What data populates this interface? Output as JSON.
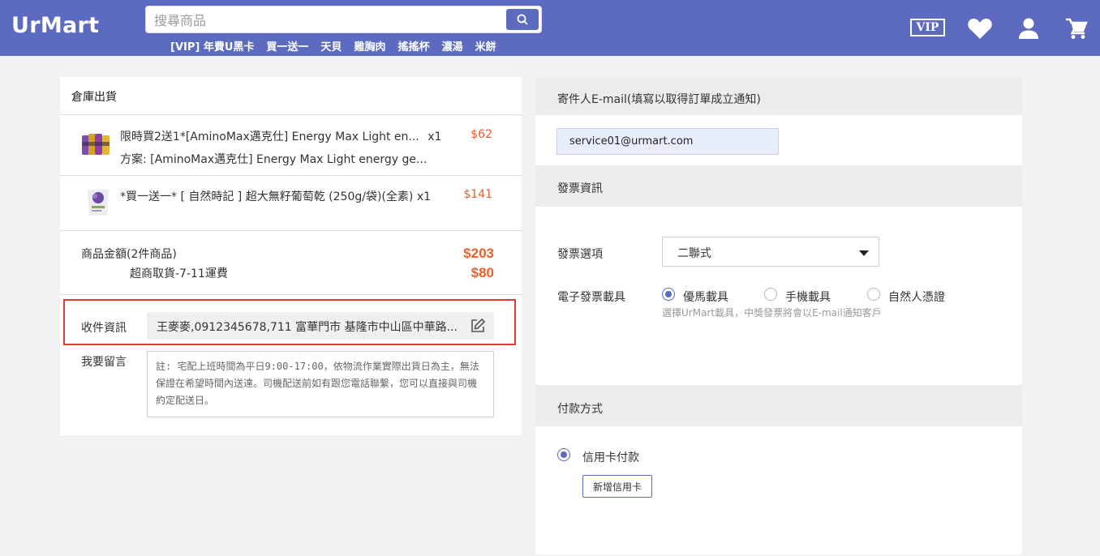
{
  "header": {
    "logo": "UrMart",
    "search_placeholder": "搜尋商品",
    "hot_links": [
      "[VIP] 年費U黑卡",
      "買一送一",
      "天貝",
      "雞胸肉",
      "搖搖杯",
      "濃湯",
      "米餅"
    ],
    "vip_label": "VIP",
    "icons": [
      "search-icon",
      "heart-icon",
      "user-icon",
      "cart-icon"
    ],
    "brand_color": "#5c6bc0"
  },
  "order": {
    "section_title": "倉庫出貨",
    "items": [
      {
        "name": "限時買2送1*[AminoMax邁克仕] Energy Max Light en...",
        "qty": "x1",
        "plan": "方案: [AminoMax邁克仕] Energy Max Light energy ge...",
        "price": "$62"
      },
      {
        "name": "*買一送一* [ 自然時記 ] 超大無籽葡萄乾 (250g/袋)(全素)",
        "qty": "x1",
        "plan": "",
        "price": "$141"
      }
    ],
    "subtotal_label": "商品金額(2件商品)",
    "subtotal": "$203",
    "shipping_label": "超商取貨-7-11運費",
    "shipping": "$80",
    "recipient_label": "收件資訊",
    "recipient_value": "王麥麥,0912345678,711 富華門市 基隆市中山區中華路...",
    "note_label": "我要留言",
    "note_text": "註: 宅配上班時間為平日9:00-17:00，依物流作業實際出貨日為主，無法保證在希望時間內送達。司機配送前如有跟您電話聯繫，您可以直接與司機約定配送日。"
  },
  "sender": {
    "title": "寄件人E-mail(填寫以取得訂單成立通知)",
    "email": "service01@urmart.com"
  },
  "invoice": {
    "title": "發票資訊",
    "option_label": "發票選項",
    "option_value": "二聯式",
    "carrier_label": "電子發票載具",
    "carriers": [
      "優馬載具",
      "手機載具",
      "自然人憑證"
    ],
    "selected_carrier": "優馬載具",
    "hint": "選擇UrMart載具，中獎發票將會以E-mail通知客戶"
  },
  "payment": {
    "title": "付款方式",
    "method": "信用卡付款",
    "add_card_label": "新增信用卡"
  },
  "colors": {
    "price": "#e8612c",
    "highlight": "#e53935"
  }
}
